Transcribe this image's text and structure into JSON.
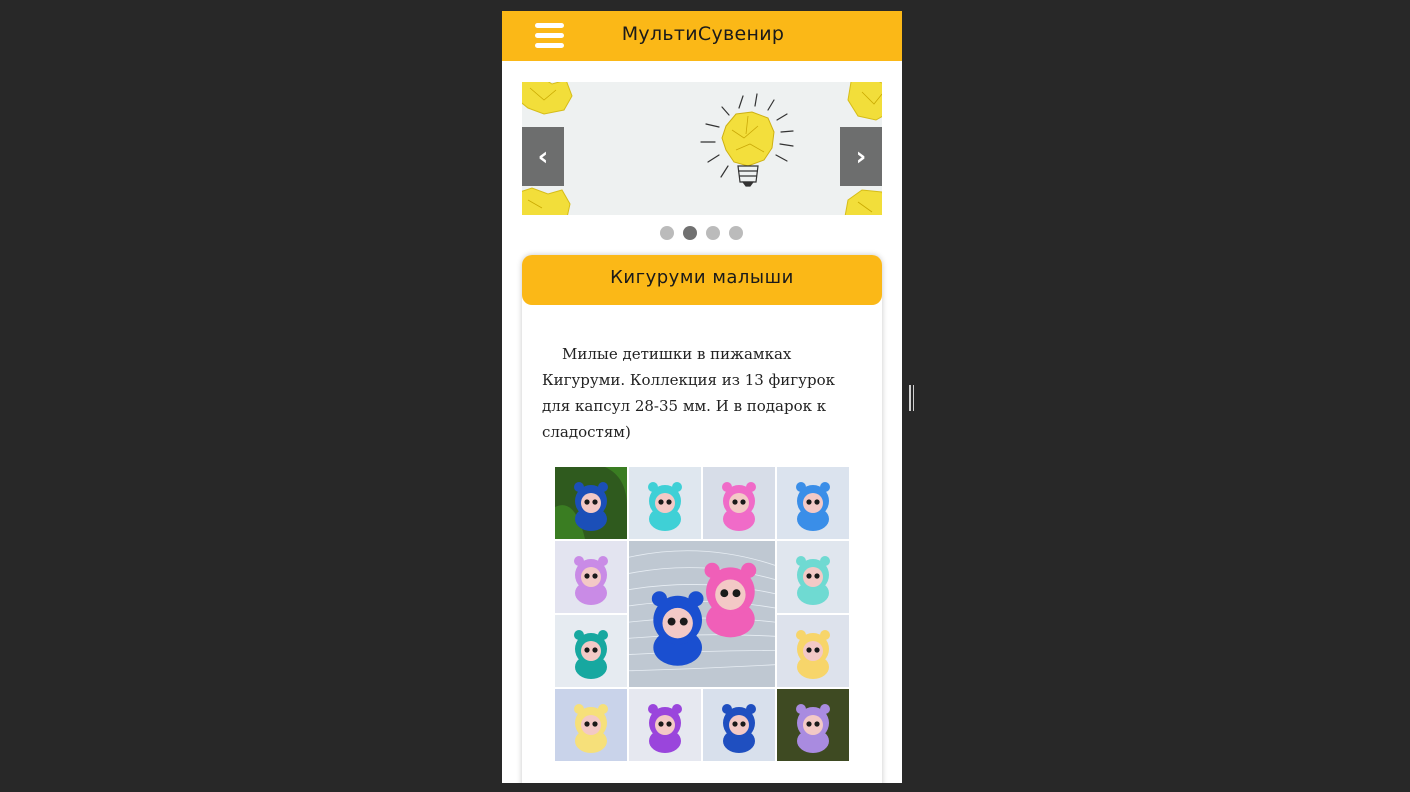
{
  "header": {
    "title": "МультиСувенир",
    "menu_icon": "hamburger-menu-icon",
    "background": "#fbb817"
  },
  "slider": {
    "prev_label": "‹",
    "next_label": "›",
    "slides_count": 4,
    "active_index": 1,
    "image": "crumpled-paper-lightbulb"
  },
  "card": {
    "title": "Кигуруми малыши",
    "description": "Милые детишки в пижамках Кигуруми. Коллекция из 13 фигурок для капсул 28-35 мм. И в подарок к сладостям)"
  },
  "gallery": {
    "tiles": [
      {
        "name": "blue-octopus-kigurumi",
        "bg": "#2f5a1e",
        "body": "#1b4fb8",
        "border": "#3a7d22"
      },
      {
        "name": "turquoise-mermaid-kigurumi",
        "bg": "#dfe7ef",
        "body": "#3fd0d6"
      },
      {
        "name": "pink-lamb-kigurumi",
        "bg": "#d7dde8",
        "body": "#f06bc8"
      },
      {
        "name": "blue-elephant-kigurumi",
        "bg": "#dbe3ee",
        "body": "#3a8ee8"
      },
      {
        "name": "purple-bunny-kigurumi",
        "bg": "#e3e4f0",
        "body": "#c98be6"
      },
      {
        "name": "collection-featured",
        "bg": "#bfc8d2",
        "body": "#1a4fd0"
      },
      {
        "name": "mint-horse-kigurumi",
        "bg": "#e0e6ee",
        "body": "#6fdad2"
      },
      {
        "name": "teal-jellyfish-kigurumi",
        "bg": "#e6ebf1",
        "body": "#17a8a0"
      },
      {
        "name": "yellow-bunny-kigurumi",
        "bg": "#dde2ec",
        "body": "#f7d56a"
      },
      {
        "name": "cream-unicorn-kigurumi",
        "bg": "#c9d3ea",
        "body": "#f6e07a"
      },
      {
        "name": "violet-bear-kigurumi",
        "bg": "#e6e8f0",
        "body": "#9a45dc"
      },
      {
        "name": "navy-cat-kigurumi",
        "bg": "#d8e0ec",
        "body": "#1f4fc0"
      },
      {
        "name": "lilac-bat-kigurumi",
        "bg": "#3e4a22",
        "body": "#a98be0"
      }
    ]
  },
  "colors": {
    "accent": "#fbb817",
    "page_background": "#282828",
    "dot_inactive": "#bbbbbb",
    "dot_active": "#717171"
  }
}
